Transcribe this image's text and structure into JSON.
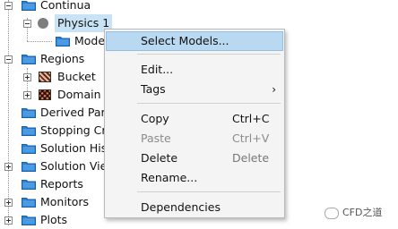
{
  "tree": {
    "continua": "Continua",
    "physics": "Physics 1",
    "models": "Models",
    "regions": "Regions",
    "bucket": "Bucket",
    "domain": "Domain",
    "derived_parts": "Derived Parts",
    "stopping_criteria": "Stopping Criteria",
    "solution_histories": "Solution Histories",
    "solution_views": "Solution Views",
    "reports": "Reports",
    "monitors": "Monitors",
    "plots": "Plots"
  },
  "menu": {
    "select_models": "Select Models...",
    "edit": "Edit...",
    "tags": "Tags",
    "copy": "Copy",
    "copy_shortcut": "Ctrl+C",
    "paste": "Paste",
    "paste_shortcut": "Ctrl+V",
    "delete": "Delete",
    "delete_shortcut": "Delete",
    "rename": "Rename...",
    "dependencies": "Dependencies"
  },
  "watermark": "CFD之道",
  "colors": {
    "folder": "#1f77c9",
    "highlight": "#b9d8f2",
    "selected": "#c9e3f6"
  },
  "icons": {
    "folder": "folder-icon",
    "physics": "physics-continuum-icon",
    "region": "region-icon"
  }
}
